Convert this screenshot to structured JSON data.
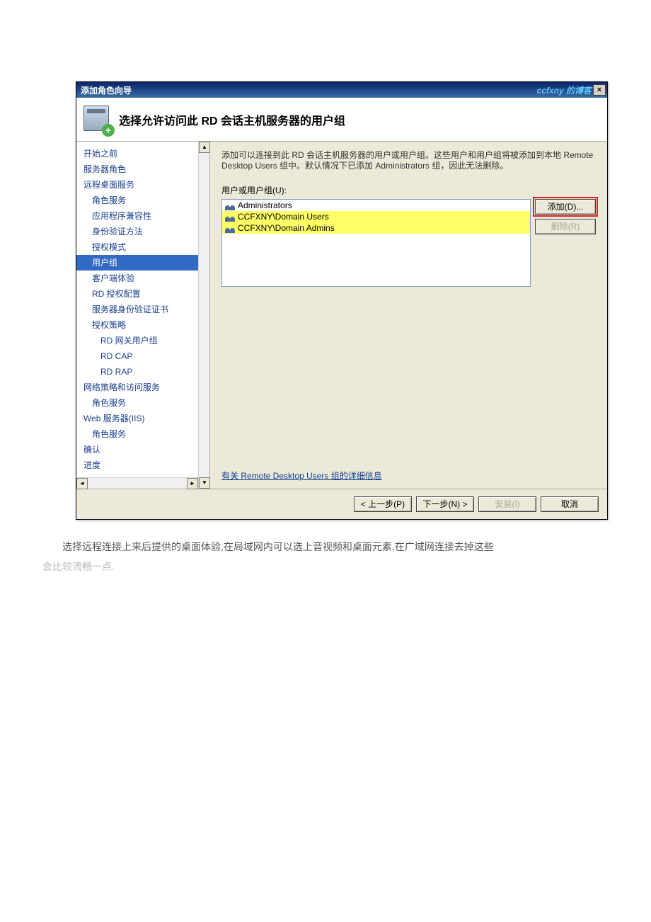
{
  "titlebar": {
    "title": "添加角色向导",
    "watermark": "ccfxny 的博客",
    "close": "×"
  },
  "header": {
    "heading": "选择允许访问此 RD 会话主机服务器的用户组",
    "plus": "+"
  },
  "sidebar": {
    "items": [
      {
        "label": "开始之前",
        "level": 0
      },
      {
        "label": "服务器角色",
        "level": 0
      },
      {
        "label": "远程桌面服务",
        "level": 0
      },
      {
        "label": "角色服务",
        "level": 1
      },
      {
        "label": "应用程序兼容性",
        "level": 1
      },
      {
        "label": "身份验证方法",
        "level": 1
      },
      {
        "label": "授权模式",
        "level": 1
      },
      {
        "label": "用户组",
        "level": 1,
        "selected": true
      },
      {
        "label": "客户端体验",
        "level": 1
      },
      {
        "label": "RD 授权配置",
        "level": 1
      },
      {
        "label": "服务器身份验证证书",
        "level": 1
      },
      {
        "label": "授权策略",
        "level": 1
      },
      {
        "label": "RD 网关用户组",
        "level": 2
      },
      {
        "label": "RD CAP",
        "level": 2
      },
      {
        "label": "RD RAP",
        "level": 2
      },
      {
        "label": "网络策略和访问服务",
        "level": 0
      },
      {
        "label": "角色服务",
        "level": 1
      },
      {
        "label": "Web 服务器(IIS)",
        "level": 0
      },
      {
        "label": "角色服务",
        "level": 1
      },
      {
        "label": "确认",
        "level": 0
      },
      {
        "label": "进度",
        "level": 0
      }
    ],
    "scroll": {
      "up": "▲",
      "down": "▼",
      "left": "◄",
      "right": "►"
    }
  },
  "content": {
    "instruction": "添加可以连接到此 RD 会话主机服务器的用户或用户组。这些用户和用户组将被添加到本地 Remote Desktop Users 组中。默认情况下已添加 Administrators 组，因此无法删除。",
    "listbox_label": "用户或用户组(U):",
    "groups": [
      {
        "name": "Administrators",
        "hl": false
      },
      {
        "name": "CCFXNY\\Domain Users",
        "hl": true
      },
      {
        "name": "CCFXNY\\Domain Admins",
        "hl": true
      }
    ],
    "add_btn": "添加(D)...",
    "remove_btn": "删除(R)",
    "link": "有关 Remote Desktop Users 组的详细信息"
  },
  "footer": {
    "prev": "< 上一步(P)",
    "next": "下一步(N) >",
    "install": "安装(I)",
    "cancel": "取消"
  },
  "caption": {
    "line1": "选择远程连接上来后提供的桌面体验,在局域网内可以选上音视频和桌面元素,在广域网连接去掉这些",
    "line2": "会比较流畅一点."
  }
}
